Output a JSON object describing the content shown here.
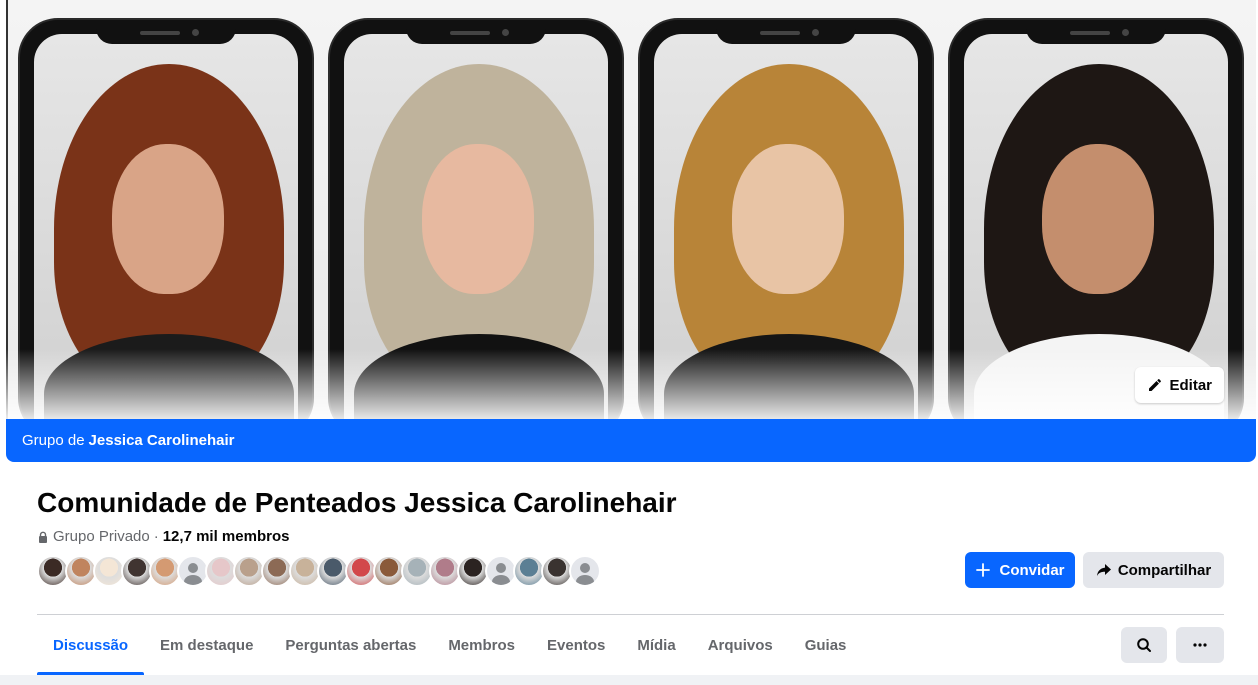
{
  "cover": {
    "edit_label": "Editar",
    "portrait_colors": [
      {
        "hair": "#7a3318",
        "skin": "#d9a487",
        "top": "#1b1b1b"
      },
      {
        "hair": "#bfb39c",
        "skin": "#e7b9a0",
        "top": "#111111"
      },
      {
        "hair": "#b88438",
        "skin": "#e8c4a5",
        "top": "#151515"
      },
      {
        "hair": "#1e1714",
        "skin": "#c48e6d",
        "top": "#f4f4f4"
      }
    ]
  },
  "group_bar": {
    "prefix": "Grupo de",
    "owner": "Jessica Carolinehair"
  },
  "header": {
    "title": "Comunidade de Penteados Jessica Carolinehair",
    "privacy": "Grupo Privado",
    "separator": "·",
    "members": "12,7 mil membros"
  },
  "avatars": [
    "#3b2a25",
    "#c0845e",
    "#f4e6d6",
    "#403431",
    "#d49a72",
    "default",
    "#e6c7c9",
    "#b9a08c",
    "#8c6a55",
    "#c8b29a",
    "#4a5a6a",
    "#d2484b",
    "#8a5a3a",
    "#a6b2b8",
    "#b07c8a",
    "#2b2321",
    "default",
    "#5b7f94",
    "#3a3330",
    "default"
  ],
  "actions": {
    "invite_label": "Convidar",
    "share_label": "Compartilhar"
  },
  "tabs": [
    {
      "label": "Discussão",
      "active": true
    },
    {
      "label": "Em destaque",
      "active": false
    },
    {
      "label": "Perguntas abertas",
      "active": false
    },
    {
      "label": "Membros",
      "active": false
    },
    {
      "label": "Eventos",
      "active": false
    },
    {
      "label": "Mídia",
      "active": false
    },
    {
      "label": "Arquivos",
      "active": false
    },
    {
      "label": "Guias",
      "active": false
    }
  ],
  "colors": {
    "accent": "#0866ff",
    "secondary_button": "#e4e6eb",
    "muted_text": "#65676b"
  }
}
